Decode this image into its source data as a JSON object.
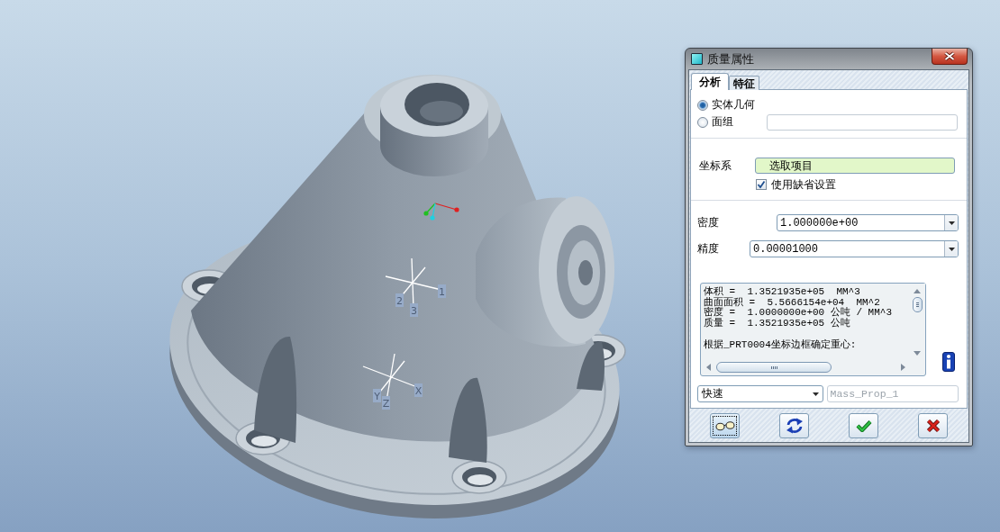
{
  "viewport": {
    "principal_axis_labels": [
      "1",
      "2",
      "3"
    ],
    "csys_labels": [
      "X",
      "Y",
      "Z"
    ]
  },
  "dialog": {
    "title": "质量属性",
    "tabs": [
      {
        "label": "分析",
        "selected": true
      },
      {
        "label": "特征",
        "selected": false
      }
    ],
    "geometry_options": [
      {
        "label": "实体几何",
        "selected": true
      },
      {
        "label": "面组",
        "selected": false
      }
    ],
    "csys": {
      "label": "坐标系",
      "value": "选取项目",
      "active": true,
      "use_default": {
        "label": "使用缺省设置",
        "checked": true
      }
    },
    "density": {
      "label": "密度",
      "value": "1.000000e+00"
    },
    "accuracy": {
      "label": "精度",
      "value": "0.00001000"
    },
    "results": {
      "lines": [
        "体积 =  1.3521935e+05  MM^3",
        "曲面面积 =  5.5666154e+04  MM^2",
        "密度 =  1.0000000e+00 公吨 / MM^3",
        "质量 =  1.3521935e+05 公吨"
      ],
      "note": "根据_PRT0004坐标边框确定重心:"
    },
    "mode": {
      "value": "快速"
    },
    "name_field": {
      "value": "Mass_Prop_1",
      "disabled": true
    },
    "buttons": [
      {
        "kind": "preview",
        "focused": true
      },
      {
        "kind": "repaint",
        "focused": false
      },
      {
        "kind": "ok",
        "focused": false
      },
      {
        "kind": "cancel",
        "focused": false
      }
    ]
  }
}
